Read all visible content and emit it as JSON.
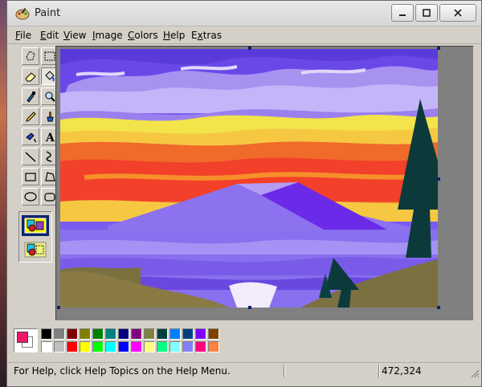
{
  "window": {
    "title": "Paint"
  },
  "menu": [
    "File",
    "Edit",
    "View",
    "Image",
    "Colors",
    "Help",
    "Extras"
  ],
  "menu_underline": [
    "F",
    "E",
    "V",
    "I",
    "C",
    "H",
    "x"
  ],
  "tools": [
    "free-form-select",
    "rect-select",
    "eraser",
    "fill-with-color",
    "pick-color",
    "magnifier",
    "pencil",
    "brush",
    "airbrush",
    "text",
    "line",
    "curve",
    "rectangle",
    "polygon",
    "ellipse",
    "rounded-rectangle"
  ],
  "active_tool": "fill-with-color",
  "colors": {
    "foreground": "#f0186a",
    "background": "#ffffff",
    "palette_top": [
      "#000000",
      "#808080",
      "#800000",
      "#808000",
      "#008000",
      "#008080",
      "#000080",
      "#800080",
      "#808040",
      "#004040",
      "#0080ff",
      "#004080",
      "#8000ff",
      "#804000"
    ],
    "palette_bottom": [
      "#ffffff",
      "#c0c0c0",
      "#ff0000",
      "#ffff00",
      "#00ff00",
      "#00ffff",
      "#0000ff",
      "#ff00ff",
      "#ffff80",
      "#00ff80",
      "#80ffff",
      "#8080ff",
      "#ff0080",
      "#ff8040"
    ]
  },
  "status": {
    "help_text": "For Help, click Help Topics on the Help Menu.",
    "coords": "472,324"
  }
}
